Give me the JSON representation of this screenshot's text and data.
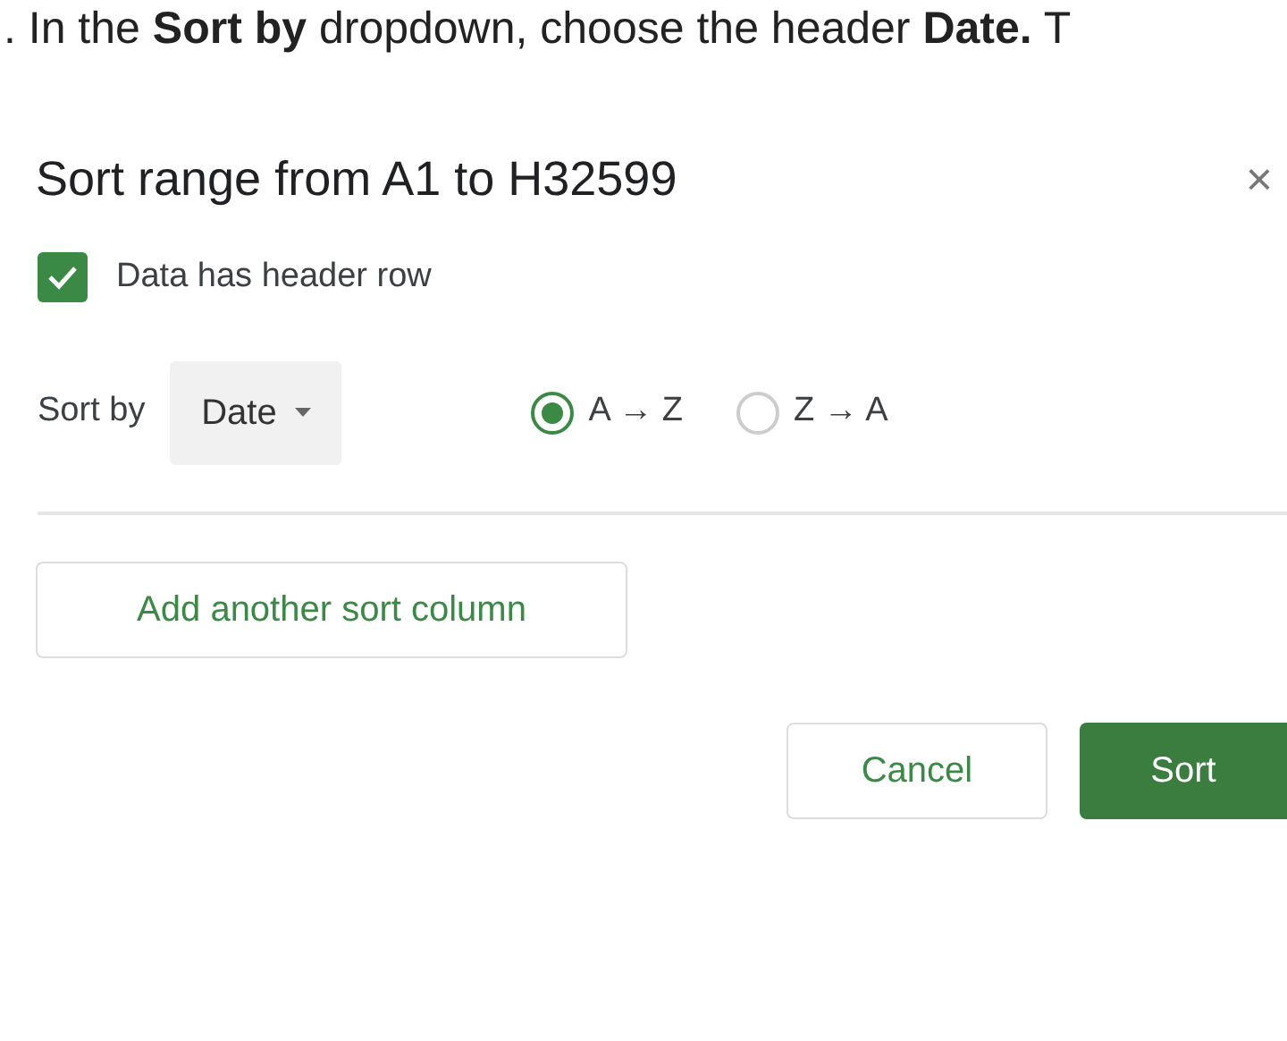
{
  "instruction": ". In the **Sort by** dropdown, choose the header **Date.** T",
  "dialog": {
    "title": "Sort range from A1 to H32599",
    "close": "×",
    "header_row": {
      "label": "Data has header row",
      "checked": true
    },
    "sort_by": {
      "label": "Sort by",
      "value": "Date"
    },
    "order": [
      {
        "label": "A → Z",
        "selected": true
      },
      {
        "label": "Z → A",
        "selected": false
      }
    ],
    "add_button": "Add another sort column",
    "buttons": [
      {
        "label": "Cancel",
        "kind": "secondary"
      },
      {
        "label": "Sort",
        "kind": "primary"
      }
    ]
  }
}
